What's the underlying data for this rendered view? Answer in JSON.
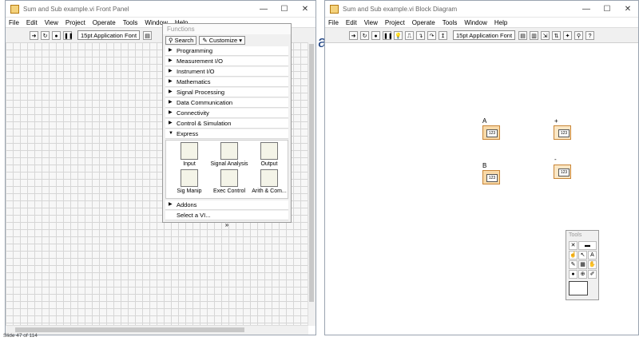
{
  "front_panel": {
    "title": "Sum and Sub example.vi Front Panel",
    "menu": [
      "File",
      "Edit",
      "View",
      "Project",
      "Operate",
      "Tools",
      "Window",
      "Help"
    ],
    "font_selector": "15pt Application Font"
  },
  "palette": {
    "title": "Functions",
    "search_label": "Search",
    "customize_label": "Customize",
    "categories": [
      "Programming",
      "Measurement I/O",
      "Instrument I/O",
      "Mathematics",
      "Signal Processing",
      "Data Communication",
      "Connectivity",
      "Control & Simulation"
    ],
    "expanded": "Express",
    "express_items": [
      "Input",
      "Signal Analysis",
      "Output",
      "Sig Manip",
      "Exec Control",
      "Arith & Com..."
    ],
    "addons": "Addons",
    "select_vi": "Select a VI...",
    "more": "»"
  },
  "block_diagram": {
    "title": "Sum and Sub example.vi Block Diagram",
    "menu": [
      "File",
      "Edit",
      "View",
      "Project",
      "Operate",
      "Tools",
      "Window",
      "Help"
    ],
    "font_selector": "15pt Application Font",
    "terminals": [
      {
        "label": "A",
        "value": "123"
      },
      {
        "label": "B",
        "value": "123"
      },
      {
        "label": "+",
        "value": "123"
      },
      {
        "label": "-",
        "value": "123"
      }
    ]
  },
  "tools_palette": {
    "title": "Tools"
  },
  "status": {
    "slide": "Slide 47 of 114"
  },
  "window_controls": {
    "minimize": "—",
    "maximize": "☐",
    "close": "✕"
  }
}
